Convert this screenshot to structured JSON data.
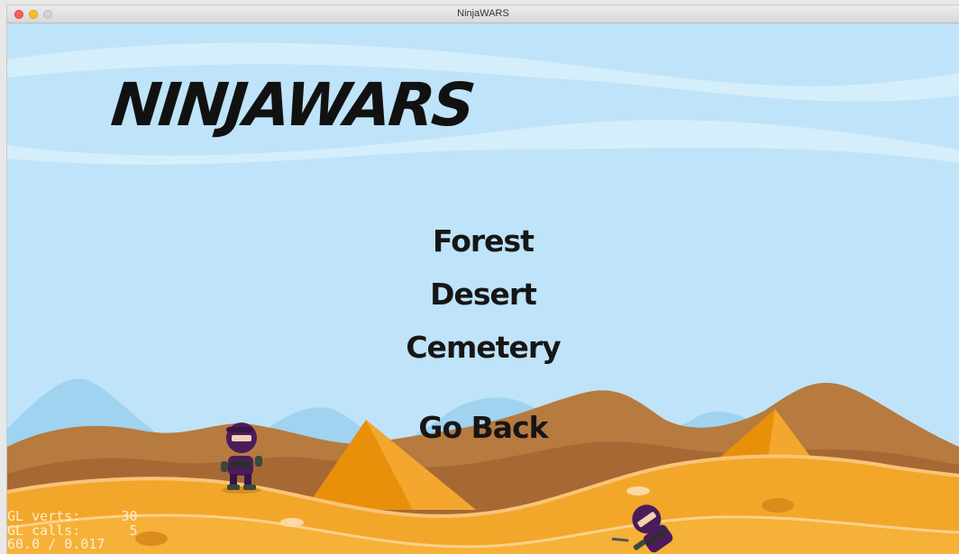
{
  "window": {
    "title": "NinjaWARS"
  },
  "game": {
    "title": "NINJAWARS"
  },
  "menu": {
    "items": [
      {
        "label": "Forest"
      },
      {
        "label": "Desert"
      },
      {
        "label": "Cemetery"
      }
    ],
    "back_label": "Go Back"
  },
  "debug": {
    "verts_label": "GL verts:",
    "verts_value": "30",
    "calls_label": "GL calls:",
    "calls_value": "5",
    "fps": "60.0 / 0.017"
  },
  "colors": {
    "sky": "#bfe3f8",
    "dune": "#f2a72a",
    "pyramid": "#e8900a",
    "ninja": "#4a1d5a"
  }
}
